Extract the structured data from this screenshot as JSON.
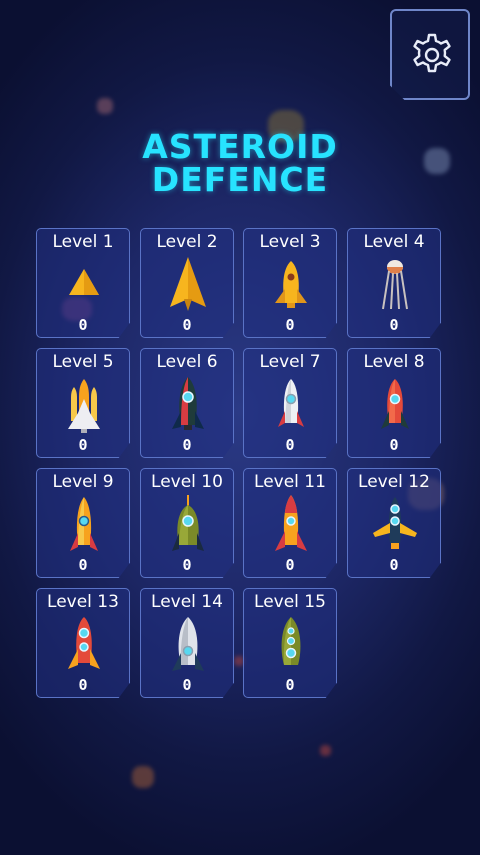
{
  "title": {
    "line1": "ASTEROID",
    "line2": "DEFENCE"
  },
  "settings": {
    "icon": "gear-icon"
  },
  "levels": [
    {
      "label": "Level 1",
      "score": "0",
      "ship": "triangle-ship-icon"
    },
    {
      "label": "Level 2",
      "score": "0",
      "ship": "paper-plane-ship-icon"
    },
    {
      "label": "Level 3",
      "score": "0",
      "ship": "small-rocket-icon"
    },
    {
      "label": "Level 4",
      "score": "0",
      "ship": "satellite-icon"
    },
    {
      "label": "Level 5",
      "score": "0",
      "ship": "space-shuttle-icon"
    },
    {
      "label": "Level 6",
      "score": "0",
      "ship": "dark-rocket-icon"
    },
    {
      "label": "Level 7",
      "score": "0",
      "ship": "white-rocket-icon"
    },
    {
      "label": "Level 8",
      "score": "0",
      "ship": "red-rocket-icon"
    },
    {
      "label": "Level 9",
      "score": "0",
      "ship": "orange-rocket-icon"
    },
    {
      "label": "Level 10",
      "score": "0",
      "ship": "green-rocket-icon"
    },
    {
      "label": "Level 11",
      "score": "0",
      "ship": "orange-red-rocket-icon"
    },
    {
      "label": "Level 12",
      "score": "0",
      "ship": "wing-ship-icon"
    },
    {
      "label": "Level 13",
      "score": "0",
      "ship": "red-capsule-rocket-icon"
    },
    {
      "label": "Level 14",
      "score": "0",
      "ship": "silver-rocket-icon"
    },
    {
      "label": "Level 15",
      "score": "0",
      "ship": "olive-rocket-icon"
    }
  ],
  "colors": {
    "title": "#27e3ff",
    "card_border": "#5a73c6",
    "background": "#1d2766"
  }
}
